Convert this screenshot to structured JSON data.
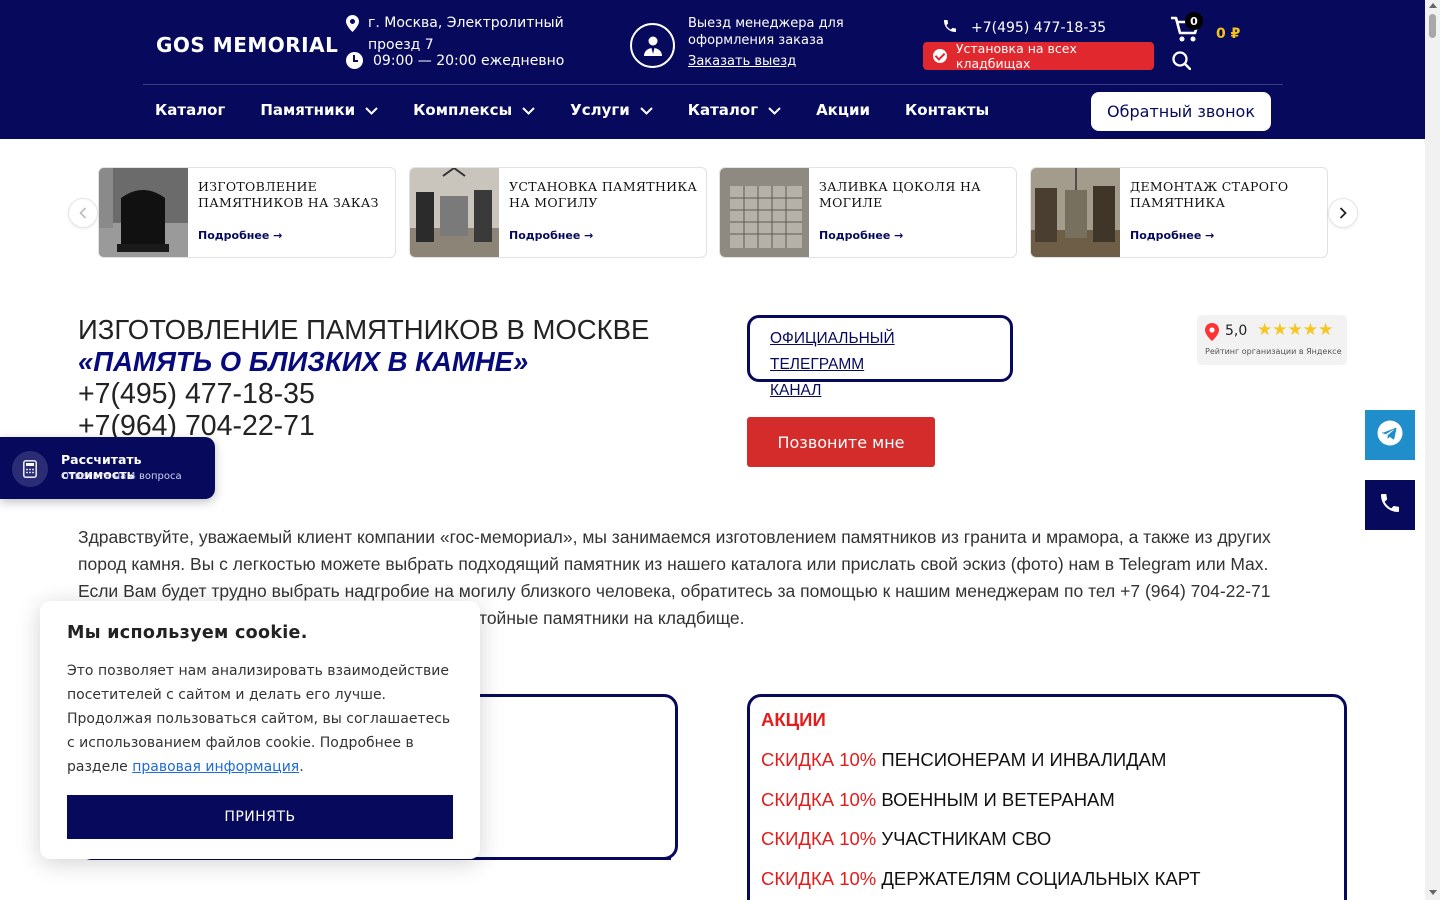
{
  "header": {
    "logo": "GOS MEMORIAL",
    "address_line1": "г. Москва, Электролитный",
    "address_line2": "проезд 7",
    "hours": "09:00 — 20:00 ежедневно",
    "manager_line1": "Выезд менеджера для",
    "manager_line2": "оформления заказа",
    "manager_link": "Заказать выезд",
    "phone": "+7(495) 477-18-35",
    "install_badge": "Установка на всех кладбищах",
    "cart_count": "0",
    "cart_sum": "0 ₽",
    "callback": "Обратный звонок"
  },
  "nav": [
    {
      "label": "Каталог",
      "dropdown": false
    },
    {
      "label": "Памятники",
      "dropdown": true
    },
    {
      "label": "Комплексы",
      "dropdown": true
    },
    {
      "label": "Услуги",
      "dropdown": true
    },
    {
      "label": "Каталог",
      "dropdown": true
    },
    {
      "label": "Акции",
      "dropdown": false
    },
    {
      "label": "Контакты",
      "dropdown": false
    }
  ],
  "services": [
    {
      "title": "Изготовление памятников на заказ",
      "more": "Подробнее"
    },
    {
      "title": "Установка памятника на могилу",
      "more": "Подробнее"
    },
    {
      "title": "Заливка цоколя на могиле",
      "more": "Подробнее"
    },
    {
      "title": "Демонтаж старого памятника",
      "more": "Подробнее"
    }
  ],
  "hero": {
    "title_line1": "ИЗГОТОВЛЕНИЕ ПАМЯТНИКОВ В МОСКВЕ",
    "title_line2": "«ПАМЯТЬ О БЛИЗКИХ В КАМНЕ»",
    "phone1": "+7(495) 477-18-35",
    "phone2": "+7(964) 704-22-71",
    "telegram_line1": "ОФИЦИАЛЬНЫЙ ТЕЛЕГРАММ",
    "telegram_line2": "КАНАЛ",
    "call_me": "Позвоните мне"
  },
  "rating": {
    "score": "5,0",
    "label": "Рейтинг организации в Яндексе",
    "stars": 5
  },
  "calc_widget": {
    "title": "Рассчитать стоимость",
    "subtitle": "Ответьте на 4 вопроса"
  },
  "intro": {
    "line1": "Здравствуйте, уважаемый клиент компании «гос-мемориал», мы занимаемся изготовлением памятников из гранита и мрамора, а также из других",
    "line2": "пород камня. Вы с легкостью можете выбрать подходящий памятник из нашего каталога или прислать свой эскиз (фото) нам в Telegram или Max.",
    "line3": "Если Вам будет трудно выбрать надгробие на могилу близкого человека, обратитесь за помощью к нашим менеджерам по тел +7 (964) 704-22-71",
    "line4": "тойные памятники на кладбище."
  },
  "promo": {
    "title": "АКЦИИ",
    "items": [
      {
        "discount": "СКИДКА 10%",
        "text": "ПЕНСИОНЕРАМ И ИНВАЛИДАМ"
      },
      {
        "discount": "СКИДКА 10%",
        "text": "ВОЕННЫМ И ВЕТЕРАНАМ"
      },
      {
        "discount": "СКИДКА 10%",
        "text": "УЧАСТНИКАМ СВО"
      },
      {
        "discount": "СКИДКА 10%",
        "text": "ДЕРЖАТЕЛЯМ СОЦИАЛЬНЫХ КАРТ"
      }
    ]
  },
  "cookie": {
    "title": "Мы используем cookie.",
    "text": "Это позволяет нам анализировать взаимодействие посетителей с сайтом и делать его лучше. Продолжая пользоваться сайтом, вы соглашаетесь с использованием файлов cookie. Подробнее в разделе ",
    "link": "правовая информация",
    "text_end": ".",
    "accept": "ПРИНЯТЬ"
  },
  "colors": {
    "brand": "#070a5c",
    "accent_red": "#e31c1c",
    "telegram": "#1f8ecb",
    "cart_sum": "#f3c21d"
  }
}
